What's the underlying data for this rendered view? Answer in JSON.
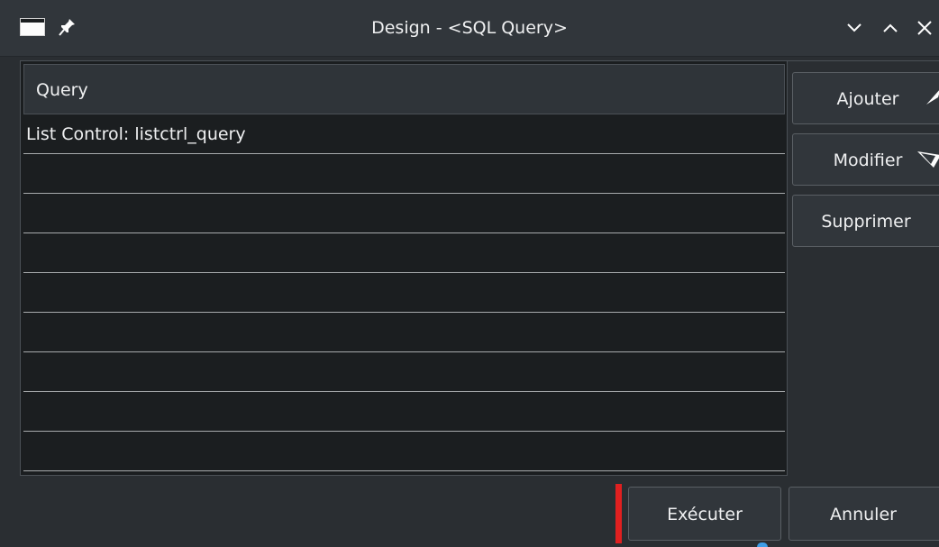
{
  "window": {
    "title": "Design - <SQL Query>"
  },
  "titlebar": {
    "icons": [
      "app-window-icon",
      "pin-icon",
      "chevron-down-icon",
      "chevron-up-icon",
      "close-icon"
    ]
  },
  "list": {
    "column_header": "Query",
    "rows": [
      "List Control: listctrl_query",
      "",
      "",
      "",
      "",
      "",
      "",
      "",
      ""
    ]
  },
  "side_buttons": {
    "add_label": "Ajouter",
    "edit_label": "Modifier",
    "delete_label": "Supprimer"
  },
  "footer": {
    "execute_label": "Exécuter",
    "cancel_label": "Annuler"
  },
  "colors": {
    "window_bg": "#2a2e32",
    "list_bg": "#1b1e20",
    "text": "#eff0f1",
    "marker_red": "#e02020"
  }
}
